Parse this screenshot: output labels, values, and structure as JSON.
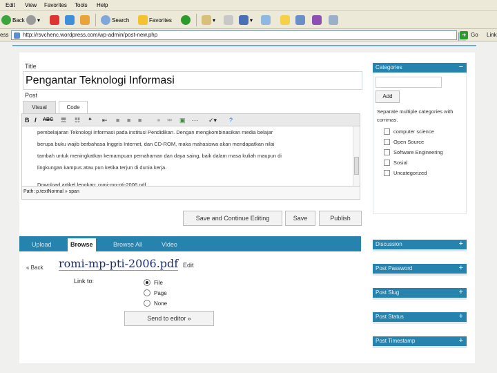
{
  "browser": {
    "menu": [
      "Edit",
      "View",
      "Favorites",
      "Tools",
      "Help"
    ],
    "toolbar": {
      "back_label": "Back",
      "search_label": "Search",
      "favorites_label": "Favorites"
    },
    "address": {
      "label": "ess",
      "url": "http://rsvchenc.wordpress.com/wp-admin/post-new.php",
      "go_label": "Go",
      "links_label": "Links"
    }
  },
  "editor": {
    "title_label": "Title",
    "title_value": "Pengantar Teknologi Informasi",
    "post_label": "Post",
    "tabs": [
      "Visual",
      "Code"
    ],
    "toolbar": {
      "bold": "B",
      "italic": "I",
      "strike": "ABC"
    },
    "content_lines": [
      "pembelajaran Teknologi Informasi pada institusi Pendidikan. Dengan mengkombinasikan media belajar",
      "berupa buku wajib berbahasa Inggris Internet, dan CD-ROM, maka mahasiswa akan mendapatkan nilai",
      "tambah untuk meningkatkan kemampuan pemahaman dan daya saing, baik dalam masa kuliah maupun di",
      "lingkungan kampus atau pun ketika terjun di dunia kerja.",
      "",
      "Download artikel lengkap: romi-mp-pti-2006.pdf"
    ],
    "path_text": "Path: p.textNormal » span"
  },
  "actions": {
    "save_continue": "Save and Continue Editing",
    "save": "Save",
    "publish": "Publish"
  },
  "uploader": {
    "tabs": [
      "Upload",
      "Browse",
      "Browse All",
      "Video"
    ],
    "back_link": "« Back",
    "file_title": "romi-mp-pti-2006.pdf",
    "edit_label": "Edit",
    "link_to_label": "Link to:",
    "link_options": [
      "File",
      "Page",
      "None"
    ],
    "selected_option": "File",
    "send_button": "Send to editor »"
  },
  "sidebar": {
    "categories": {
      "heading": "Categories",
      "toggle": "−",
      "add_button": "Add",
      "note": "Separate multiple categories with commas.",
      "items": [
        "computer science",
        "Open Source",
        "Software Engineering",
        "Sosial",
        "Uncategorized"
      ]
    },
    "panels": [
      {
        "heading": "Discussion",
        "toggle": "+"
      },
      {
        "heading": "Post Password",
        "toggle": "+"
      },
      {
        "heading": "Post Slug",
        "toggle": "+"
      },
      {
        "heading": "Post Status",
        "toggle": "+"
      },
      {
        "heading": "Post Timestamp",
        "toggle": "+"
      }
    ]
  },
  "colors": {
    "accent": "#2583ad",
    "chrome": "#ece9d8",
    "title_link": "#1b2c6b"
  }
}
